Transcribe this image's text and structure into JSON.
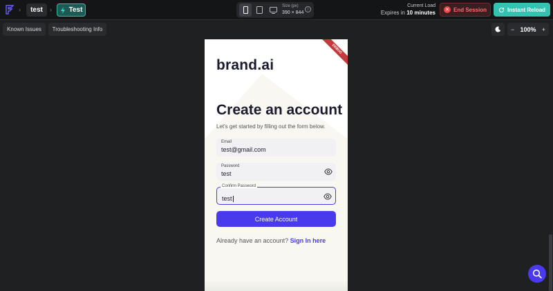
{
  "topbar": {
    "crumb_project": "test",
    "crumb_branch": "Test",
    "size_label": "Size (px)",
    "size_value": "390 × 844",
    "current_load": "Current Load",
    "expires_prefix": "Expires in",
    "expires_value": "10 minutes",
    "end_session": "End Session",
    "instant_reload": "Instant Reload"
  },
  "toolbar": {
    "known_issues": "Known Issues",
    "troubleshooting": "Troubleshooting Info",
    "zoom_minus": "−",
    "zoom_value": "100%",
    "zoom_plus": "+"
  },
  "app": {
    "debug_ribbon": "DEBUG",
    "brand": "brand.ai",
    "title": "Create an account",
    "subtitle": "Let's get started by filling out the form below.",
    "email_label": "Email",
    "email_value": "test@gmail.com",
    "password_label": "Password",
    "password_value": "test",
    "confirm_label": "Confirm Password",
    "confirm_value": "test",
    "create_button": "Create Account",
    "already_text": "Already have an account?",
    "sign_in_link": "Sign In here"
  },
  "colors": {
    "accent": "#4a3aed",
    "reload": "#35c3b1",
    "end_session": "#ff6a6a"
  }
}
